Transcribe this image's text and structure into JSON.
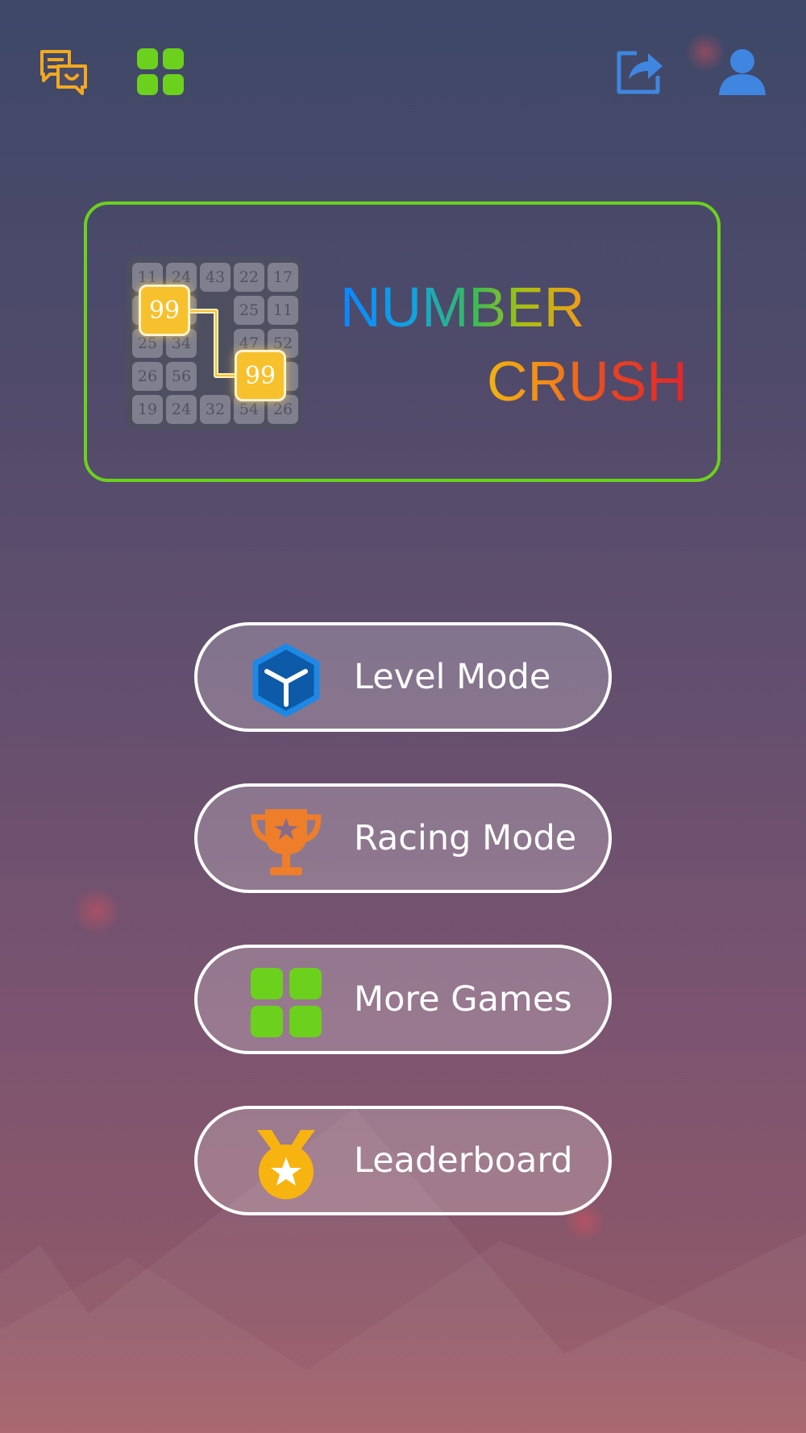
{
  "header": {
    "feedback_icon": "chat-bubbles-icon",
    "games_icon": "four-squares-icon",
    "share_icon": "share-icon",
    "profile_icon": "user-icon",
    "colors": {
      "feedback": "#f3a91f",
      "games": "#6cd11c",
      "share": "#3f86e0",
      "profile": "#3f86e0"
    }
  },
  "logo": {
    "title_line1": "NUMBER",
    "title_line2": "CRUSH",
    "grid_numbers": [
      [
        "11",
        "24",
        "43",
        "22",
        "17"
      ],
      [
        "",
        "",
        "",
        "25",
        "11"
      ],
      [
        "25",
        "34",
        "",
        "47",
        "52"
      ],
      [
        "26",
        "56",
        "",
        "",
        ""
      ],
      [
        "19",
        "24",
        "32",
        "54",
        "26"
      ]
    ],
    "highlight_tiles": [
      "99",
      "99"
    ],
    "border_color": "#6cd11c"
  },
  "menu": {
    "buttons": [
      {
        "label": "Level Mode",
        "icon": "cube-icon",
        "color": "#1565c8"
      },
      {
        "label": "Racing Mode",
        "icon": "trophy-icon",
        "color": "#ef7e2a"
      },
      {
        "label": "More Games",
        "icon": "four-squares-icon",
        "color": "#6cd11c"
      },
      {
        "label": "Leaderboard",
        "icon": "medal-icon",
        "color": "#f7b411"
      }
    ]
  }
}
